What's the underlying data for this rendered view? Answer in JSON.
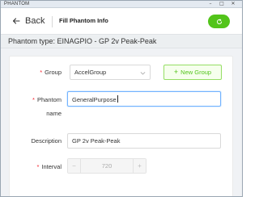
{
  "window": {
    "title": "PHANTOM",
    "controls": {
      "minimize": "–",
      "maximize": "□",
      "close": "✕"
    }
  },
  "header": {
    "back_label": "Back",
    "page_title": "Fill Phantom Info",
    "refresh_icon": "refresh-icon",
    "accent_color": "#52c41a"
  },
  "phantom_type": "Phantom type: EINAGPIO - GP 2v Peak-Peak",
  "form": {
    "group": {
      "label": "Group",
      "required": true,
      "value": "AccelGroup"
    },
    "new_group_button": {
      "plus": "+",
      "label": "New Group"
    },
    "phantom_name": {
      "label_line1": "Phantom",
      "label_line2": "name",
      "required": true,
      "value": "GeneralPurpose"
    },
    "description": {
      "label": "Description",
      "required": false,
      "value": "GP 2v Peak-Peak"
    },
    "interval": {
      "label": "Interval",
      "required": true,
      "value": "720",
      "decrement": "−",
      "increment": "+"
    }
  }
}
